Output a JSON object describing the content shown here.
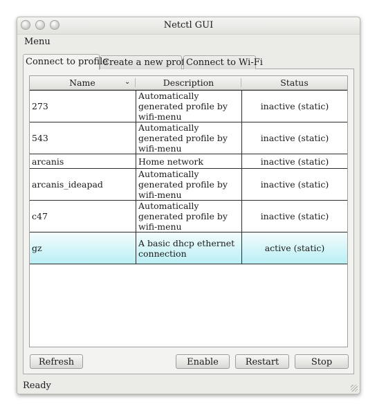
{
  "window": {
    "title": "Netctl GUI"
  },
  "menubar": {
    "menu_label": "Menu"
  },
  "tabs": [
    {
      "label": "Connect to profile",
      "active": true
    },
    {
      "label": "Create a new profile",
      "active": false
    },
    {
      "label": "Connect to Wi-Fi",
      "active": false
    }
  ],
  "table": {
    "columns": [
      "Name",
      "Description",
      "Status"
    ],
    "rows": [
      {
        "name": "273",
        "description": "Automatically generated profile by wifi-menu",
        "status": "inactive (static)"
      },
      {
        "name": "543",
        "description": "Automatically generated profile by wifi-menu",
        "status": "inactive (static)"
      },
      {
        "name": "arcanis",
        "description": "Home network",
        "status": "inactive (static)"
      },
      {
        "name": "arcanis_ideapad",
        "description": "Automatically generated profile by wifi-menu",
        "status": "inactive (static)"
      },
      {
        "name": "c47",
        "description": "Automatically generated profile by wifi-menu",
        "status": "inactive (static)"
      },
      {
        "name": "gz",
        "description": "A basic dhcp ethernet connection",
        "status": "active (static)",
        "selected": true
      }
    ]
  },
  "buttons": {
    "refresh": "Refresh",
    "enable": "Enable",
    "restart": "Restart",
    "stop": "Stop"
  },
  "statusbar": {
    "text": "Ready"
  },
  "colors": {
    "selection": "#b9eff4",
    "window_bg": "#ebebe8"
  }
}
